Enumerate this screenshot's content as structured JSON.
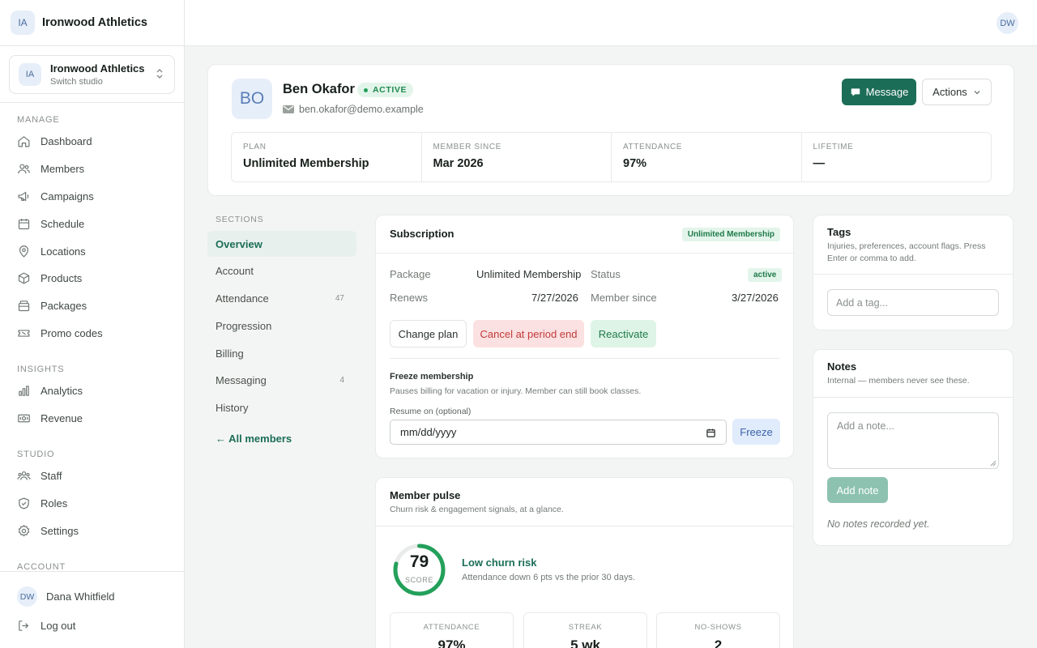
{
  "sidebar": {
    "brand_initials": "IA",
    "brand_name": "Ironwood Athletics",
    "studio": {
      "initials": "IA",
      "name": "Ironwood Athletics",
      "sub": "Switch studio"
    },
    "sections": {
      "manage": "MANAGE",
      "insights": "INSIGHTS",
      "studio": "STUDIO",
      "account": "ACCOUNT"
    },
    "manage_items": [
      {
        "label": "Dashboard",
        "icon": "home-icon"
      },
      {
        "label": "Members",
        "icon": "users-icon"
      },
      {
        "label": "Campaigns",
        "icon": "megaphone-icon"
      },
      {
        "label": "Schedule",
        "icon": "calendar-icon"
      },
      {
        "label": "Locations",
        "icon": "map-pin-icon"
      },
      {
        "label": "Products",
        "icon": "box-icon"
      },
      {
        "label": "Packages",
        "icon": "package-icon"
      },
      {
        "label": "Promo codes",
        "icon": "ticket-icon"
      }
    ],
    "insights_items": [
      {
        "label": "Analytics",
        "icon": "bar-chart-icon"
      },
      {
        "label": "Revenue",
        "icon": "banknote-icon"
      }
    ],
    "studio_items": [
      {
        "label": "Staff",
        "icon": "team-icon"
      },
      {
        "label": "Roles",
        "icon": "shield-icon"
      },
      {
        "label": "Settings",
        "icon": "gear-icon"
      }
    ],
    "user": {
      "initials": "DW",
      "name": "Dana Whitfield"
    },
    "logout": "Log out"
  },
  "topbar": {
    "avatar_initials": "DW"
  },
  "profile": {
    "initials": "BO",
    "name": "Ben Okafor",
    "status": "ACTIVE",
    "email": "ben.okafor@demo.example",
    "message_label": "Message",
    "actions_label": "Actions",
    "stats": [
      {
        "label": "PLAN",
        "value": "Unlimited Membership"
      },
      {
        "label": "MEMBER SINCE",
        "value": "Mar 2026"
      },
      {
        "label": "ATTENDANCE",
        "value": "97%"
      },
      {
        "label": "LIFETIME",
        "value": "—"
      }
    ]
  },
  "sections_nav": {
    "label": "SECTIONS",
    "items": [
      {
        "label": "Overview",
        "count": ""
      },
      {
        "label": "Account",
        "count": ""
      },
      {
        "label": "Attendance",
        "count": "47"
      },
      {
        "label": "Progression",
        "count": ""
      },
      {
        "label": "Billing",
        "count": ""
      },
      {
        "label": "Messaging",
        "count": "4"
      },
      {
        "label": "History",
        "count": ""
      }
    ],
    "all_members": "← All members"
  },
  "subscription": {
    "title": "Subscription",
    "plan_badge": "Unlimited Membership",
    "package_label": "Package",
    "package_value": "Unlimited Membership",
    "status_label": "Status",
    "status_value": "active",
    "renews_label": "Renews",
    "renews_value": "7/27/2026",
    "member_since_label": "Member since",
    "member_since_value": "3/27/2026",
    "change_plan": "Change plan",
    "cancel": "Cancel at period end",
    "reactivate": "Reactivate",
    "freeze_title": "Freeze membership",
    "freeze_sub": "Pauses billing for vacation or injury. Member can still book classes.",
    "resume_label": "Resume on (optional)",
    "date_placeholder": "mm/dd/yyyy",
    "freeze_btn": "Freeze"
  },
  "pulse": {
    "title": "Member pulse",
    "sub": "Churn risk & engagement signals, at a glance.",
    "score": "79",
    "score_value": 79,
    "score_label": "SCORE",
    "risk": "Low churn risk",
    "risk_sub": "Attendance down 6 pts vs the prior 30 days.",
    "metrics": [
      {
        "label": "ATTENDANCE",
        "value": "97%"
      },
      {
        "label": "STREAK",
        "value": "5 wk"
      },
      {
        "label": "NO-SHOWS",
        "value": "2"
      }
    ],
    "ring_color": "#23a05a"
  },
  "tags": {
    "title": "Tags",
    "sub": "Injuries, preferences, account flags. Press Enter or comma to add.",
    "placeholder": "Add a tag..."
  },
  "notes": {
    "title": "Notes",
    "sub": "Internal — members never see these.",
    "placeholder": "Add a note...",
    "add_btn": "Add note",
    "empty": "No notes recorded yet."
  },
  "colors": {
    "accent": "#1c6d57",
    "success": "#23a05a",
    "danger": "#c23a3a"
  }
}
